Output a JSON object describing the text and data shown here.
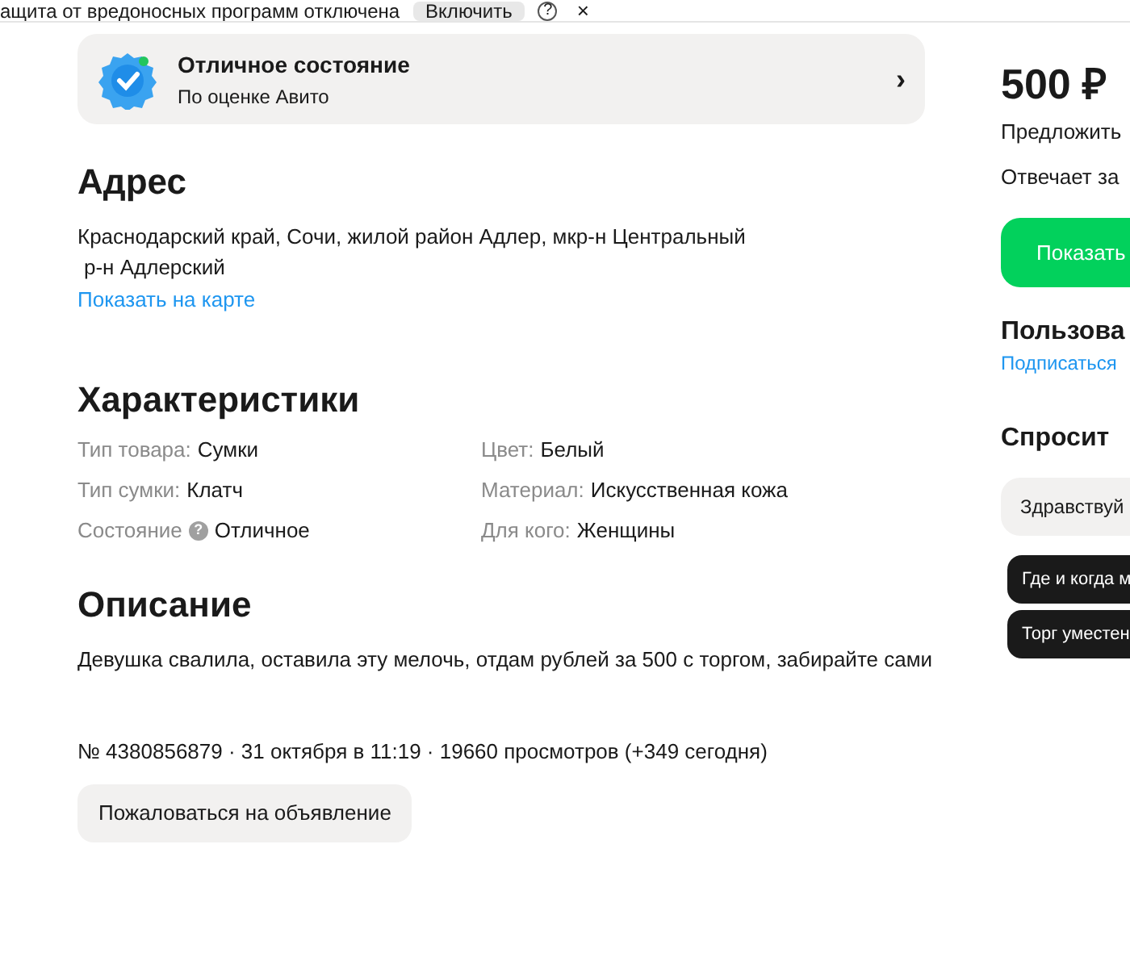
{
  "notice_bar": {
    "text": "ащита от вредоносных программ отключена",
    "button": "Включить",
    "help": "?",
    "close": "×"
  },
  "condition_card": {
    "title": "Отличное состояние",
    "subtitle": "По оценке Авито",
    "chevron": "›"
  },
  "address": {
    "heading": "Адрес",
    "line_1": "Краснодарский край, Сочи, жилой район Адлер, мкр-н Центральный",
    "line_2": "р-н Адлерский",
    "map_link": "Показать на карте"
  },
  "characteristics": {
    "heading": "Характеристики",
    "items": [
      {
        "label": "Тип товара:",
        "value": "Сумки"
      },
      {
        "label": "Цвет:",
        "value": "Белый"
      },
      {
        "label": "Тип сумки:",
        "value": "Клатч"
      },
      {
        "label": "Материал:",
        "value": "Искусственная кожа"
      },
      {
        "label": "Состояние",
        "help_icon": "?",
        "value": "Отличное"
      },
      {
        "label": "Для кого:",
        "value": "Женщины"
      }
    ]
  },
  "description": {
    "heading": "Описание",
    "text": "Девушка свалила, оставила эту мелочь, отдам рублей за 500 с торгом, забирайте сами"
  },
  "meta": "№ 4380856879 · 31 октября в 11:19 · 19660 просмотров (+349 сегодня)",
  "report_button": "Пожаловаться на объявление",
  "sidebar": {
    "price": "500 ₽",
    "offer": "Предложить",
    "responds": "Отвечает за",
    "show_button": "Показать",
    "seller_heading": "Пользова",
    "subscribe_link": "Подписаться",
    "ask_heading": "Спросит",
    "message_placeholder": "Здравствуй",
    "quick_replies": [
      "Где и когда м",
      "Торг уместен"
    ]
  }
}
